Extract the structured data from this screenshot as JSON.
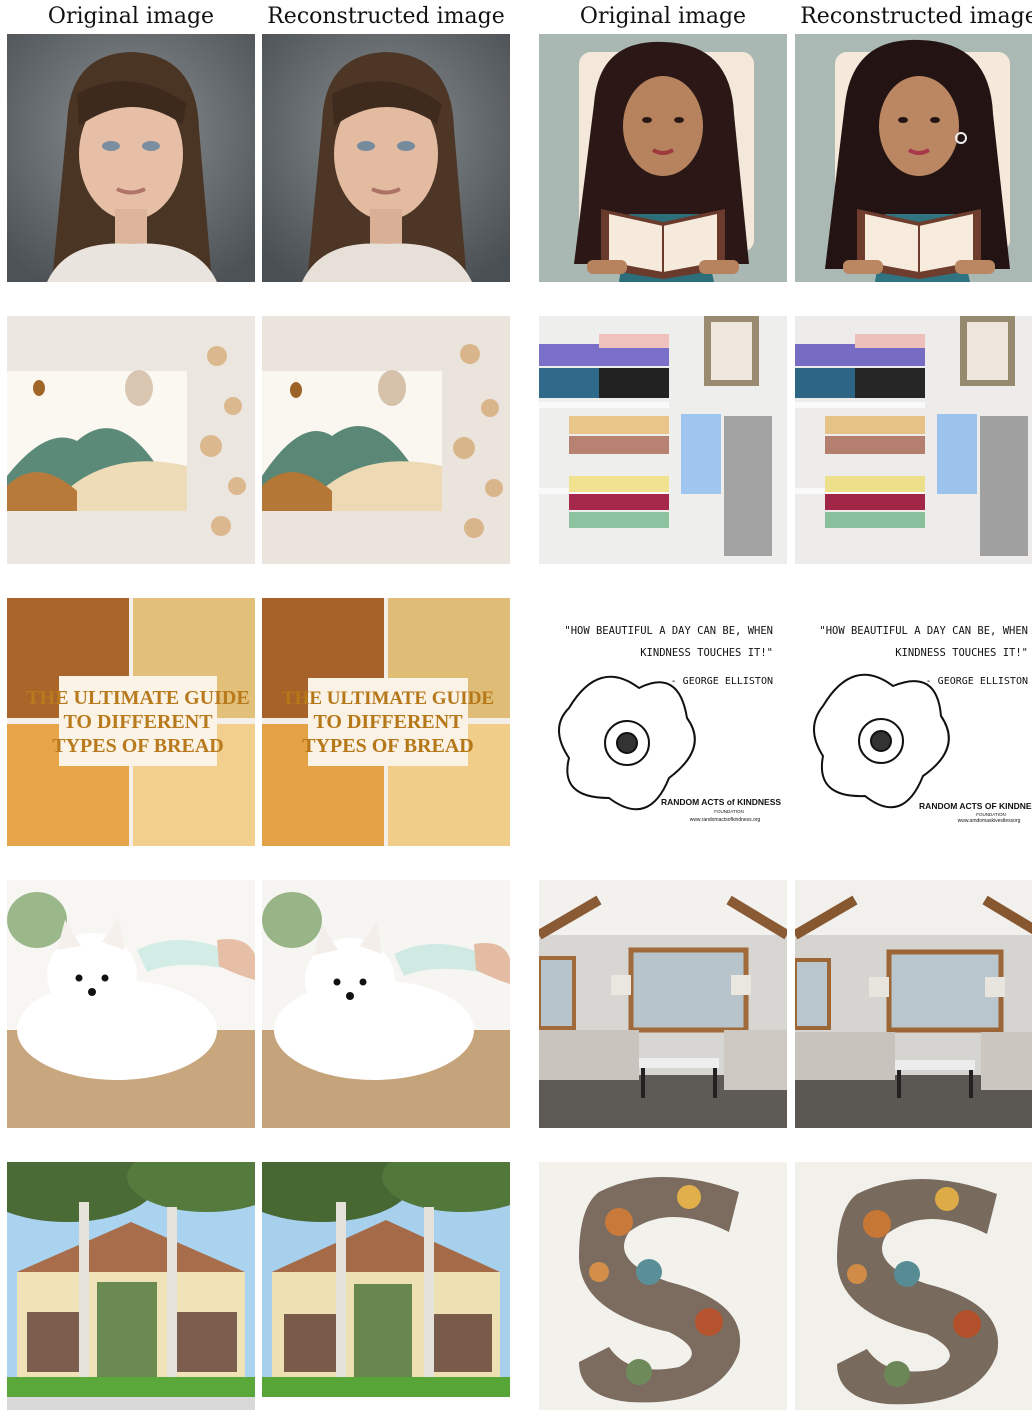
{
  "headers": {
    "left_original": "Original image",
    "left_reconstructed": "Reconstructed image",
    "right_original": "Original image",
    "right_reconstructed": "Reconstructed image"
  },
  "bread_banner": {
    "line1": "THE ULTIMATE GUIDE",
    "line2": "TO DIFFERENT",
    "line3": "TYPES OF BREAD"
  },
  "quote_original": {
    "line1": "\"HOW BEAUTIFUL A DAY CAN BE, WHEN",
    "line2": "KINDNESS TOUCHES IT!\"",
    "author": "- GEORGE ELLISTON",
    "org": "RANDOM ACTS of KINDNESS",
    "org_sub": "FOUNDATION",
    "url": "www.randomactsofkindness.org"
  },
  "quote_reconstructed": {
    "line1": "\"HOW BEAUTIFUL A DAY CAN BE, WHEN",
    "line2": "KINDNESS TOUCHES IT!\"",
    "author": "- GEORGE ELLISTON",
    "org": "RANDOM ACTS OF KINDNESS",
    "org_sub": "FOUNDATION",
    "url": "www.amdomaskivestlessorg"
  },
  "colors": {
    "portrait_bg": "#6f7478",
    "illustration_bg": "#a9b8b2",
    "paper_bg": "#ece6e0",
    "bread_crust": "#b5702c",
    "banner_text": "#b87a1c",
    "dog_floor": "#c9a77e",
    "room_wall": "#d8d6d2",
    "sky": "#a9d3ee",
    "stone_bg": "#f2f1ec"
  }
}
